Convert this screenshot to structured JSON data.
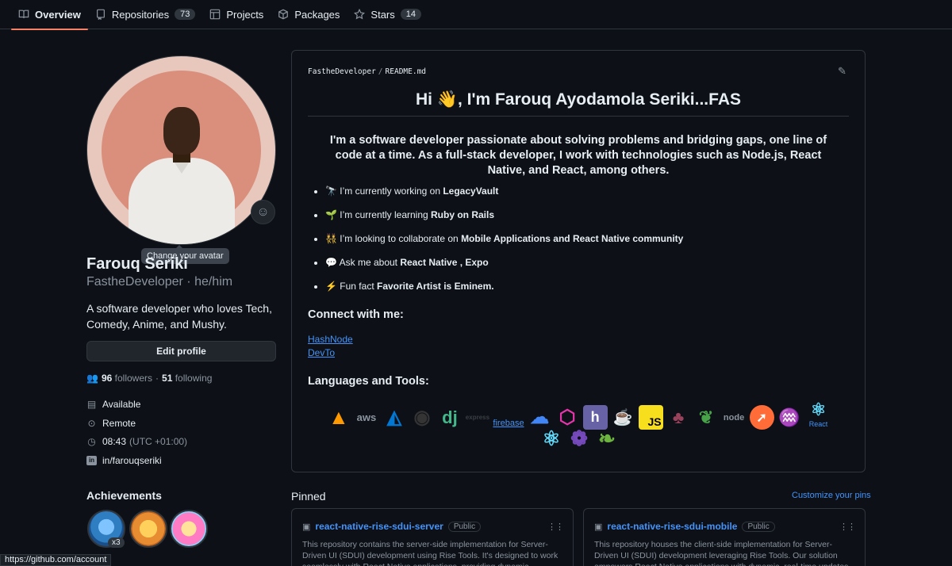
{
  "tabs": [
    {
      "label": "Overview",
      "icon": "book-icon",
      "counter": null
    },
    {
      "label": "Repositories",
      "icon": "repo-icon",
      "counter": "73"
    },
    {
      "label": "Projects",
      "icon": "table-icon",
      "counter": null
    },
    {
      "label": "Packages",
      "icon": "package-icon",
      "counter": null
    },
    {
      "label": "Stars",
      "icon": "star-icon",
      "counter": "14"
    }
  ],
  "profile": {
    "avatar_tooltip": "Change your avatar",
    "full_name": "Farouq Seriki",
    "username_line": "FastheDeveloper · he/him",
    "bio": "A software developer who loves Tech, Comedy, Anime, and Mushy.",
    "edit_button": "Edit profile",
    "followers_count": "96",
    "followers_label": "followers",
    "following_count": "51",
    "following_label": "following",
    "status": "Available",
    "location": "Remote",
    "local_time": "08:43",
    "timezone": "(UTC +01:00)",
    "linkedin": "in/farouqseriki"
  },
  "achievements": {
    "title": "Achievements",
    "badge_count": "x3"
  },
  "status_bar_url": "https://github.com/account",
  "readme": {
    "path_owner": "FastheDeveloper",
    "path_sep": "/",
    "path_file": "README.md",
    "title": "Hi 👋, I'm Farouq Ayodamola Seriki...FAS",
    "intro": "I'm a software developer passionate about solving problems and bridging gaps, one line of code at a time. As a full-stack developer, I work with technologies such as Node.js, React Native, and React, among others.",
    "bullets": [
      {
        "emoji": "🔭",
        "text": "I’m currently working on ",
        "bold": "LegacyVault"
      },
      {
        "emoji": "🌱",
        "text": "I’m currently learning ",
        "bold": "Ruby on Rails"
      },
      {
        "emoji": "👯",
        "text": "I’m looking to collaborate on ",
        "bold": "Mobile Applications and React Native community"
      },
      {
        "emoji": "💬",
        "text": "Ask me about ",
        "bold": "React Native , Expo"
      },
      {
        "emoji": "⚡",
        "text": "Fun fact ",
        "bold": "Favorite Artist is Eminem."
      }
    ],
    "connect_title": "Connect with me:",
    "links": [
      "HashNode",
      "DevTo"
    ],
    "tools_title": "Languages and Tools:",
    "firebase_text": "firebase",
    "react_text": "React"
  },
  "pinned": {
    "title": "Pinned",
    "customize": "Customize your pins",
    "cards": [
      {
        "name": "react-native-rise-sdui-server",
        "visibility": "Public",
        "description": "This repository contains the server-side implementation for Server-Driven UI (SDUI) development using Rise Tools. It's designed to work seamlessly with React Native applications, providing dynamic"
      },
      {
        "name": "react-native-rise-sdui-mobile",
        "visibility": "Public",
        "description": "This repository houses the client-side implementation for Server-Driven UI (SDUI) development leveraging Rise Tools. Our solution empowers React Native applications with dynamic, real-time updates"
      }
    ]
  },
  "colors": {
    "accent_tab": "#f78166",
    "link": "#4493f8",
    "bg": "#0d1117",
    "border": "#30363d"
  }
}
